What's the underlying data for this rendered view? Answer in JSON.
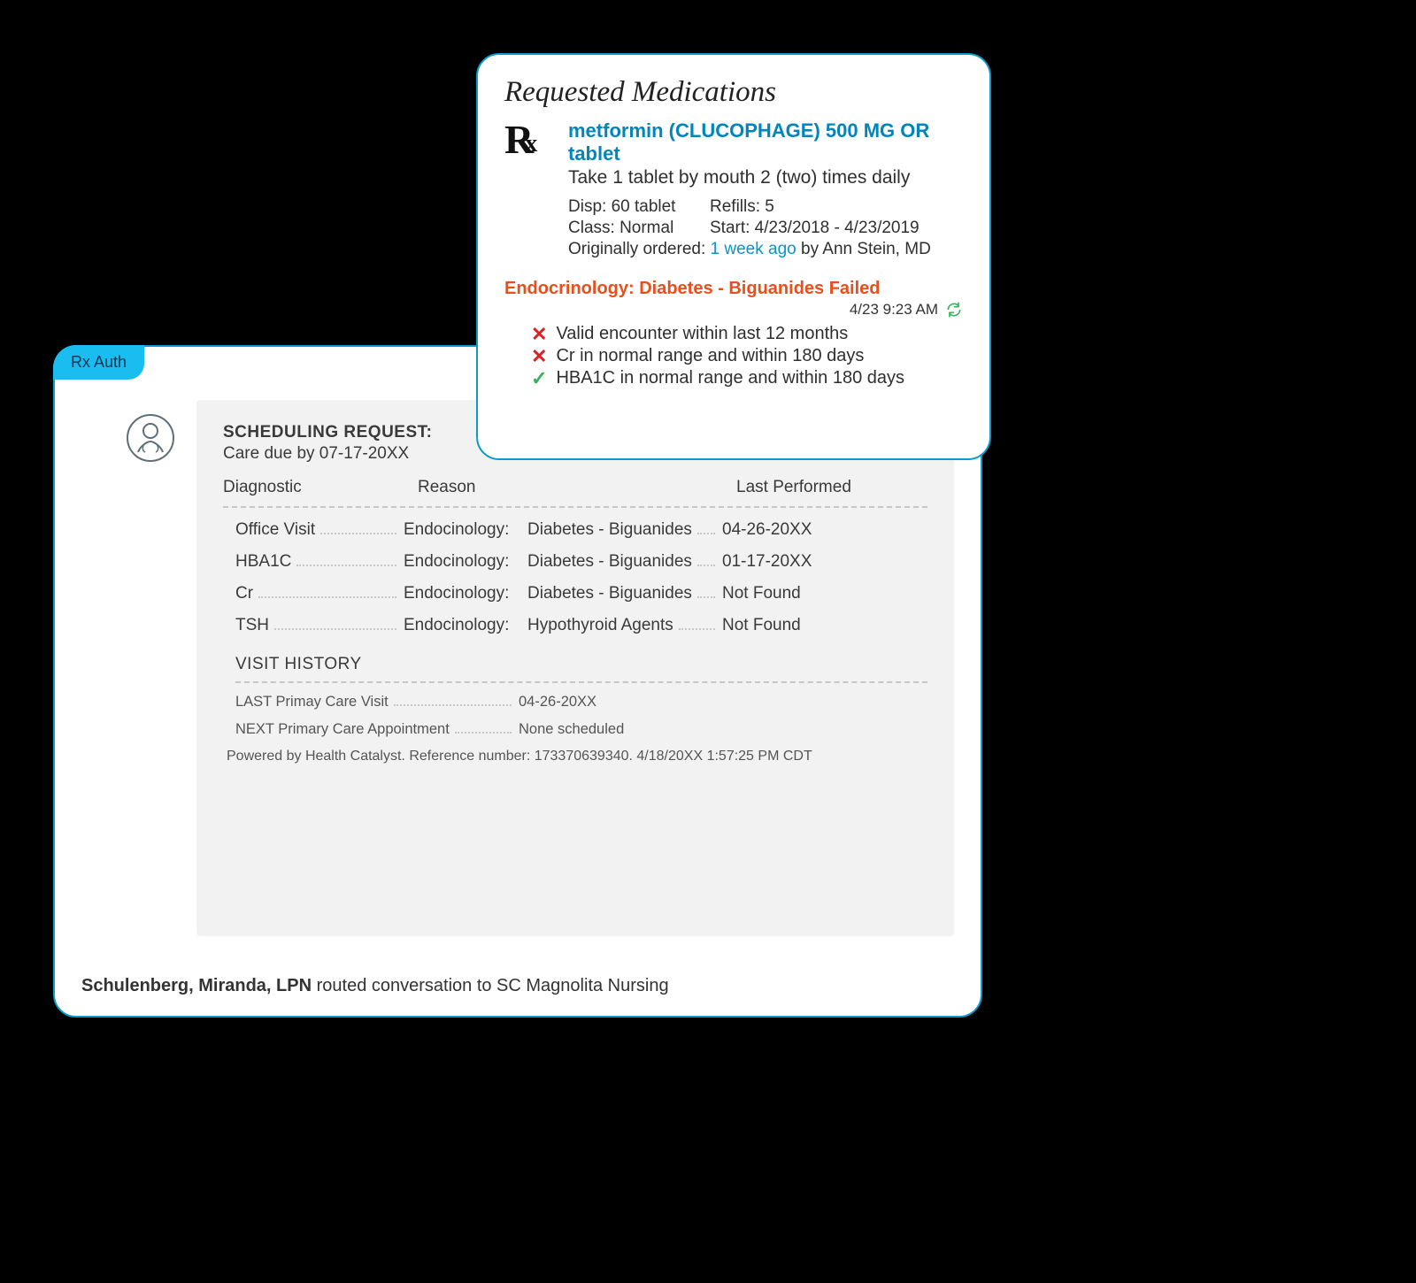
{
  "main": {
    "tab_label": "Rx Auth",
    "sched_title": "SCHEDULING REQUEST:",
    "sched_sub": "Care due by 07-17-20XX",
    "columns": {
      "diag": "Diagnostic",
      "reason": "Reason",
      "last": "Last Performed"
    },
    "rows": [
      {
        "diag": "Office Visit",
        "r1": "Endocinology:",
        "r2": "Diabetes - Biguanides",
        "last": "04-26-20XX"
      },
      {
        "diag": "HBA1C",
        "r1": "Endocinology:",
        "r2": "Diabetes - Biguanides",
        "last": "01-17-20XX"
      },
      {
        "diag": "Cr",
        "r1": "Endocinology:",
        "r2": "Diabetes - Biguanides",
        "last": "Not Found"
      },
      {
        "diag": "TSH",
        "r1": "Endocinology:",
        "r2": "Hypothyroid Agents",
        "last": "Not Found"
      }
    ],
    "visit_header": "VISIT HISTORY",
    "visits": [
      {
        "label": "LAST Primay Care Visit",
        "value": "04-26-20XX"
      },
      {
        "label": "NEXT Primary Care Appointment",
        "value": "None scheduled"
      }
    ],
    "footer": "Powered by Health Catalyst. Reference number: 173370639340. 4/18/20XX 1:57:25 PM CDT",
    "route_bold": "Schulenberg, Miranda, LPN",
    "route_rest": " routed conversation to SC Magnolita Nursing"
  },
  "popover": {
    "title": "Requested Medications",
    "med_name": "metformin (CLUCOPHAGE) 500 MG OR tablet",
    "instructions": "Take 1 tablet by mouth 2 (two) times daily",
    "disp": "Disp: 60 tablet",
    "refills": "Refills: 5",
    "class": "Class: Normal",
    "start": "Start: 4/23/2018 - 4/23/2019",
    "orig_pre": "Originally ordered: ",
    "orig_hl": "1 week ago",
    "orig_post": " by Ann Stein, MD",
    "alert": "Endocrinology: Diabetes - Biguanides Failed",
    "timestamp": "4/23 9:23 AM",
    "checks": [
      {
        "pass": false,
        "text": "Valid encounter within last 12 months"
      },
      {
        "pass": false,
        "text": "Cr in normal range and within 180 days"
      },
      {
        "pass": true,
        "text": "HBA1C in normal range and within 180 days"
      }
    ]
  }
}
